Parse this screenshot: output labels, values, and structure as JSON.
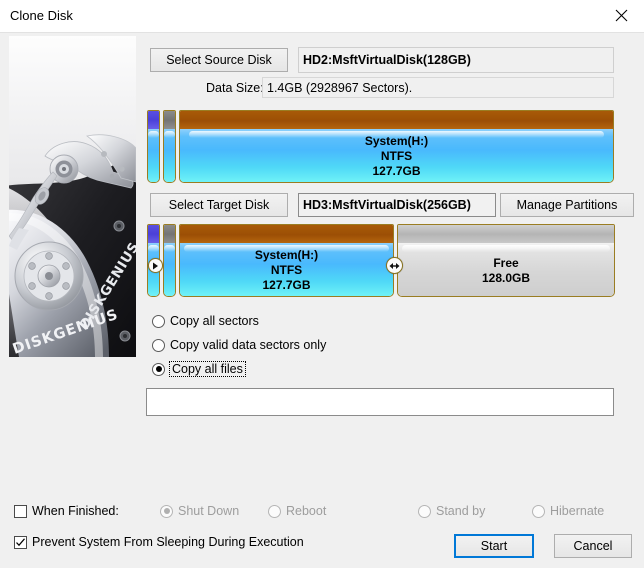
{
  "window": {
    "title": "Clone Disk",
    "close_icon": "close-icon"
  },
  "source": {
    "select_button": "Select Source Disk",
    "disk_value": "HD2:MsftVirtualDisk(128GB)",
    "data_size_label": "Data Size:",
    "data_size_value": "1.4GB (2928967 Sectors)."
  },
  "target": {
    "select_button": "Select Target Disk",
    "disk_value": "HD3:MsftVirtualDisk(256GB)",
    "manage_button": "Manage Partitions"
  },
  "source_disk_map": {
    "partitions": [
      {
        "name": "",
        "fs": "",
        "size": "",
        "kind": "efi",
        "header_color": "#4b40d8",
        "width_pct": 2.8
      },
      {
        "name": "",
        "fs": "",
        "size": "",
        "kind": "msr",
        "header_color": "#747474",
        "width_pct": 2.8
      },
      {
        "name": "System(H:)",
        "fs": "NTFS",
        "size": "127.7GB",
        "kind": "ntfs",
        "header_color": "#9c4f05",
        "width_pct": 92.0
      }
    ]
  },
  "target_disk_map": {
    "partitions": [
      {
        "name": "",
        "fs": "",
        "size": "",
        "kind": "efi",
        "header_color": "#4b40d8",
        "width_pct": 2.8
      },
      {
        "name": "",
        "fs": "",
        "size": "",
        "kind": "msr",
        "header_color": "#747474",
        "width_pct": 2.8
      },
      {
        "name": "System(H:)",
        "fs": "NTFS",
        "size": "127.7GB",
        "kind": "ntfs",
        "header_color": "#9c4f05",
        "width_pct": 45.6
      },
      {
        "name": "Free",
        "fs": "",
        "size": "128.0GB",
        "kind": "free",
        "header_color": "#b4b4b4",
        "width_pct": 46.2
      }
    ],
    "left_marker_icon": "play-right-icon",
    "resize_handle_icon": "resize-horizontal-icon"
  },
  "copy_mode": {
    "options": [
      {
        "label": "Copy all sectors",
        "selected": false,
        "focused": false
      },
      {
        "label": "Copy valid data sectors only",
        "selected": false,
        "focused": false
      },
      {
        "label": "Copy all files",
        "selected": true,
        "focused": true
      }
    ]
  },
  "progress": {
    "value": ""
  },
  "footer": {
    "when_finished_label": "When Finished:",
    "when_finished_checked": false,
    "after_actions": [
      {
        "label": "Shut Down",
        "selected": true,
        "disabled": true
      },
      {
        "label": "Reboot",
        "selected": false,
        "disabled": true
      },
      {
        "label": "Stand by",
        "selected": false,
        "disabled": true
      },
      {
        "label": "Hibernate",
        "selected": false,
        "disabled": true
      }
    ],
    "prevent_sleep_label": "Prevent System From Sleeping During Execution",
    "prevent_sleep_checked": true,
    "start_button": "Start",
    "cancel_button": "Cancel",
    "focus_color": "#0078d7"
  },
  "branding": {
    "logo_text": "DISKGENIUS"
  }
}
